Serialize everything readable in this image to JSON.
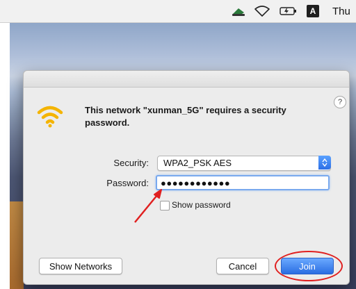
{
  "menubar": {
    "icons": [
      "network-drive-icon",
      "wifi-icon",
      "battery-icon"
    ],
    "input_menu": "A",
    "clock": "Thu"
  },
  "dialog": {
    "icon": "wifi-icon",
    "message": "This network \"xunman_5G\" requires a security password.",
    "help": "?",
    "security_label": "Security:",
    "security_value": "WPA2_PSK AES",
    "password_label": "Password:",
    "password_value": "●●●●●●●●●●●●",
    "show_password_label": "Show password",
    "show_password_checked": false,
    "show_networks_button": "Show Networks",
    "cancel_button": "Cancel",
    "join_button": "Join"
  },
  "colors": {
    "accent": "#2a6de2",
    "wifi_icon": "#f4b400",
    "annotation": "#e02020"
  }
}
